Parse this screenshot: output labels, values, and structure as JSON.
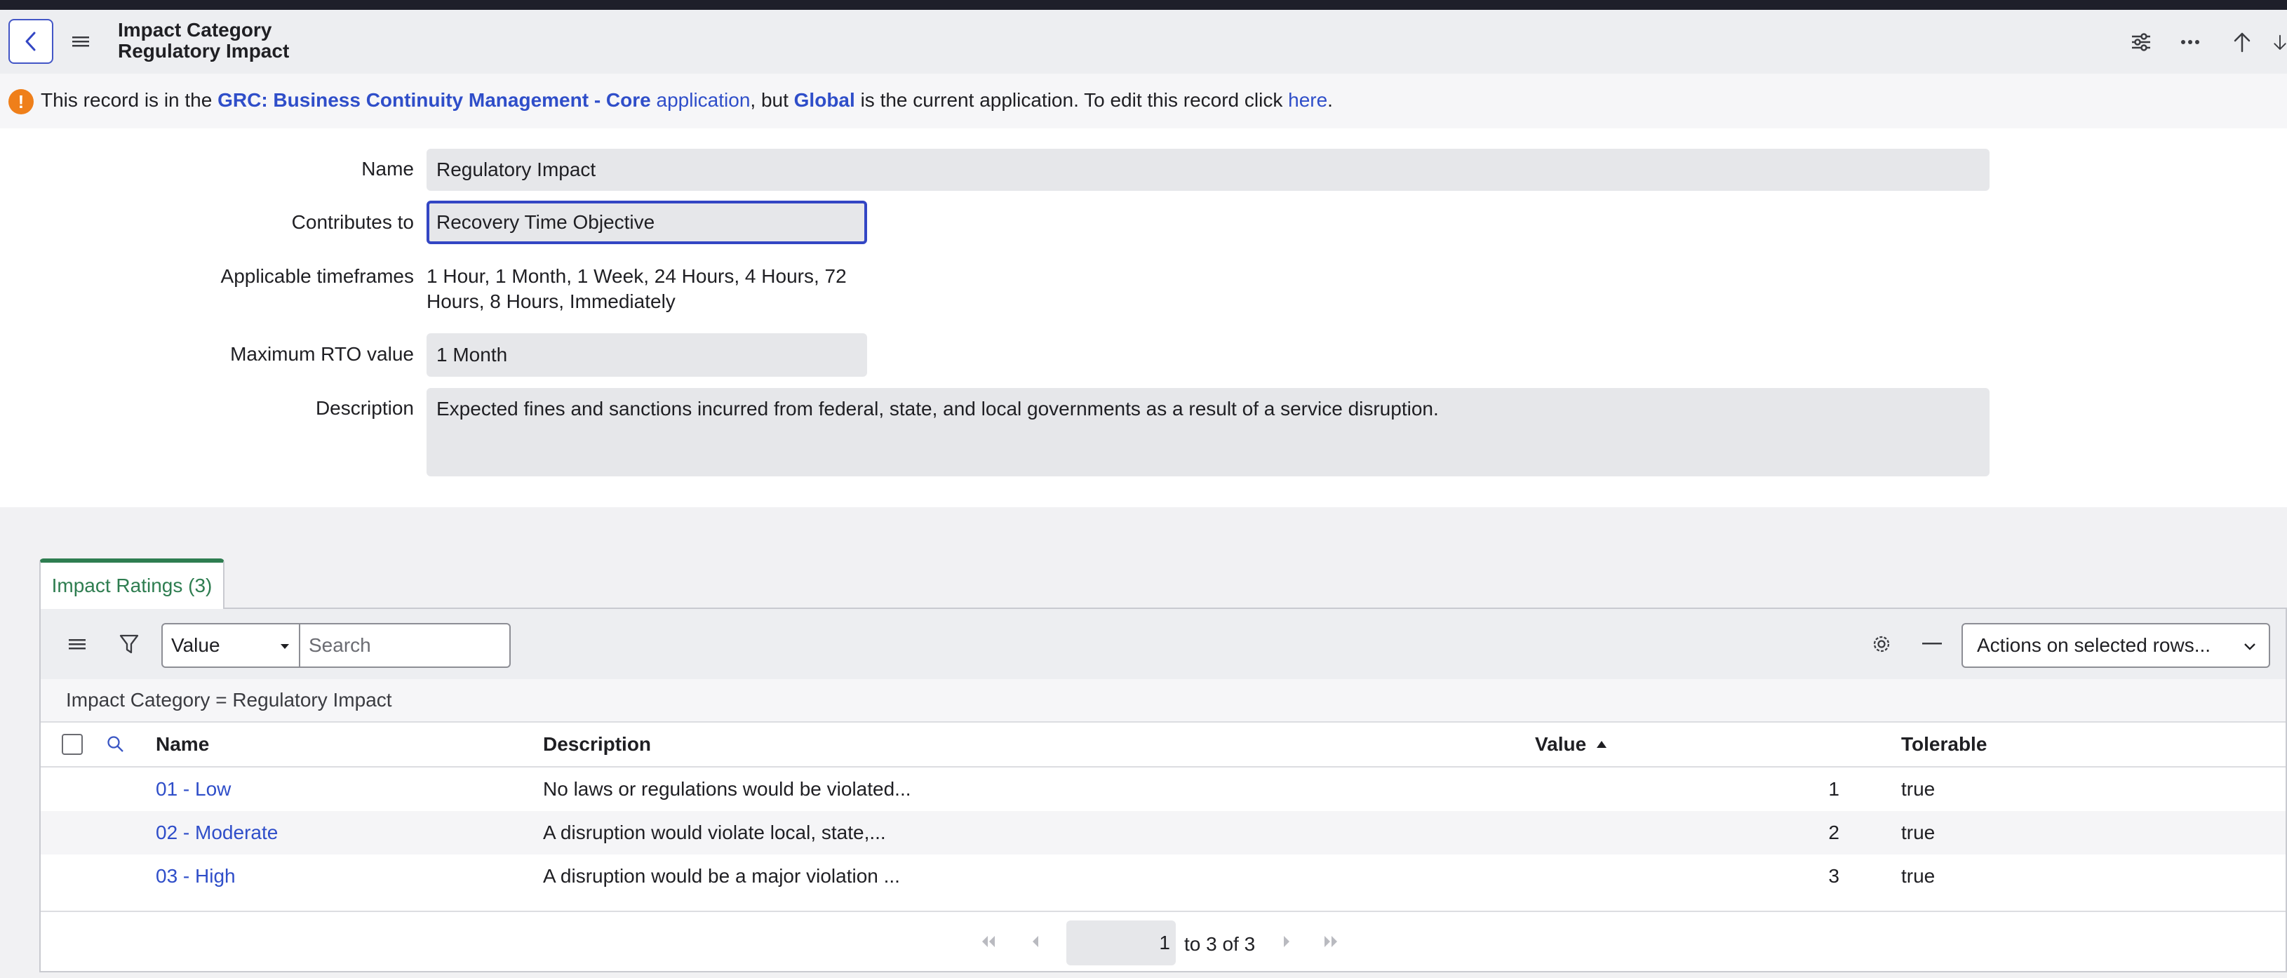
{
  "header": {
    "title_line1": "Impact Category",
    "title_line2": "Regulatory Impact"
  },
  "notice": {
    "prefix": "This record is in the",
    "app_name": "GRC: Business Continuity Management - Core",
    "app_word": "application",
    "middle": ", but",
    "current_app": "Global",
    "suffix": "is the current application. To edit this record click",
    "link": "here",
    "end": "."
  },
  "form": {
    "name_label": "Name",
    "name_value": "Regulatory Impact",
    "contributes_label": "Contributes to",
    "contributes_value": "Recovery Time Objective",
    "timeframes_label": "Applicable timeframes",
    "timeframes_line1": "1 Hour, 1 Month, 1 Week, 24 Hours, 4 Hours, 72",
    "timeframes_line2": "Hours, 8 Hours, Immediately",
    "max_rto_label": "Maximum RTO value",
    "max_rto_value": "1 Month",
    "description_label": "Description",
    "description_value": "Expected fines and sanctions incurred from federal, state, and local governments as a result of a service disruption."
  },
  "related": {
    "tab_label": "Impact Ratings (3)",
    "search_field_select": "Value",
    "search_placeholder": "Search",
    "actions_label": "Actions on selected rows...",
    "breadcrumb": "Impact Category = Regulatory Impact",
    "columns": {
      "name": "Name",
      "description": "Description",
      "value": "Value",
      "tolerable": "Tolerable"
    },
    "rows": [
      {
        "name": "01 - Low",
        "description": "No laws or regulations would be violated...",
        "value": "1",
        "tolerable": "true"
      },
      {
        "name": "02 - Moderate",
        "description": "A disruption would violate local, state,...",
        "value": "2",
        "tolerable": "true"
      },
      {
        "name": "03 - High",
        "description": "A disruption would be a major violation ...",
        "value": "3",
        "tolerable": "true"
      }
    ],
    "pager": {
      "page": "1",
      "range": "to 3 of 3"
    }
  },
  "colors": {
    "accent": "#3346c4",
    "link": "#2f4ec9",
    "tab_green": "#2e7d50",
    "warning": "#ef7f1a"
  },
  "icons": [
    "back-icon",
    "menu-icon",
    "settings-sliders-icon",
    "more-icon",
    "up-arrow-icon",
    "warning-icon",
    "filter-icon",
    "search-icon",
    "gear-icon",
    "minimize-icon",
    "chevron-down-icon",
    "sort-up-icon",
    "first-page-icon",
    "prev-page-icon",
    "next-page-icon",
    "last-page-icon"
  ]
}
